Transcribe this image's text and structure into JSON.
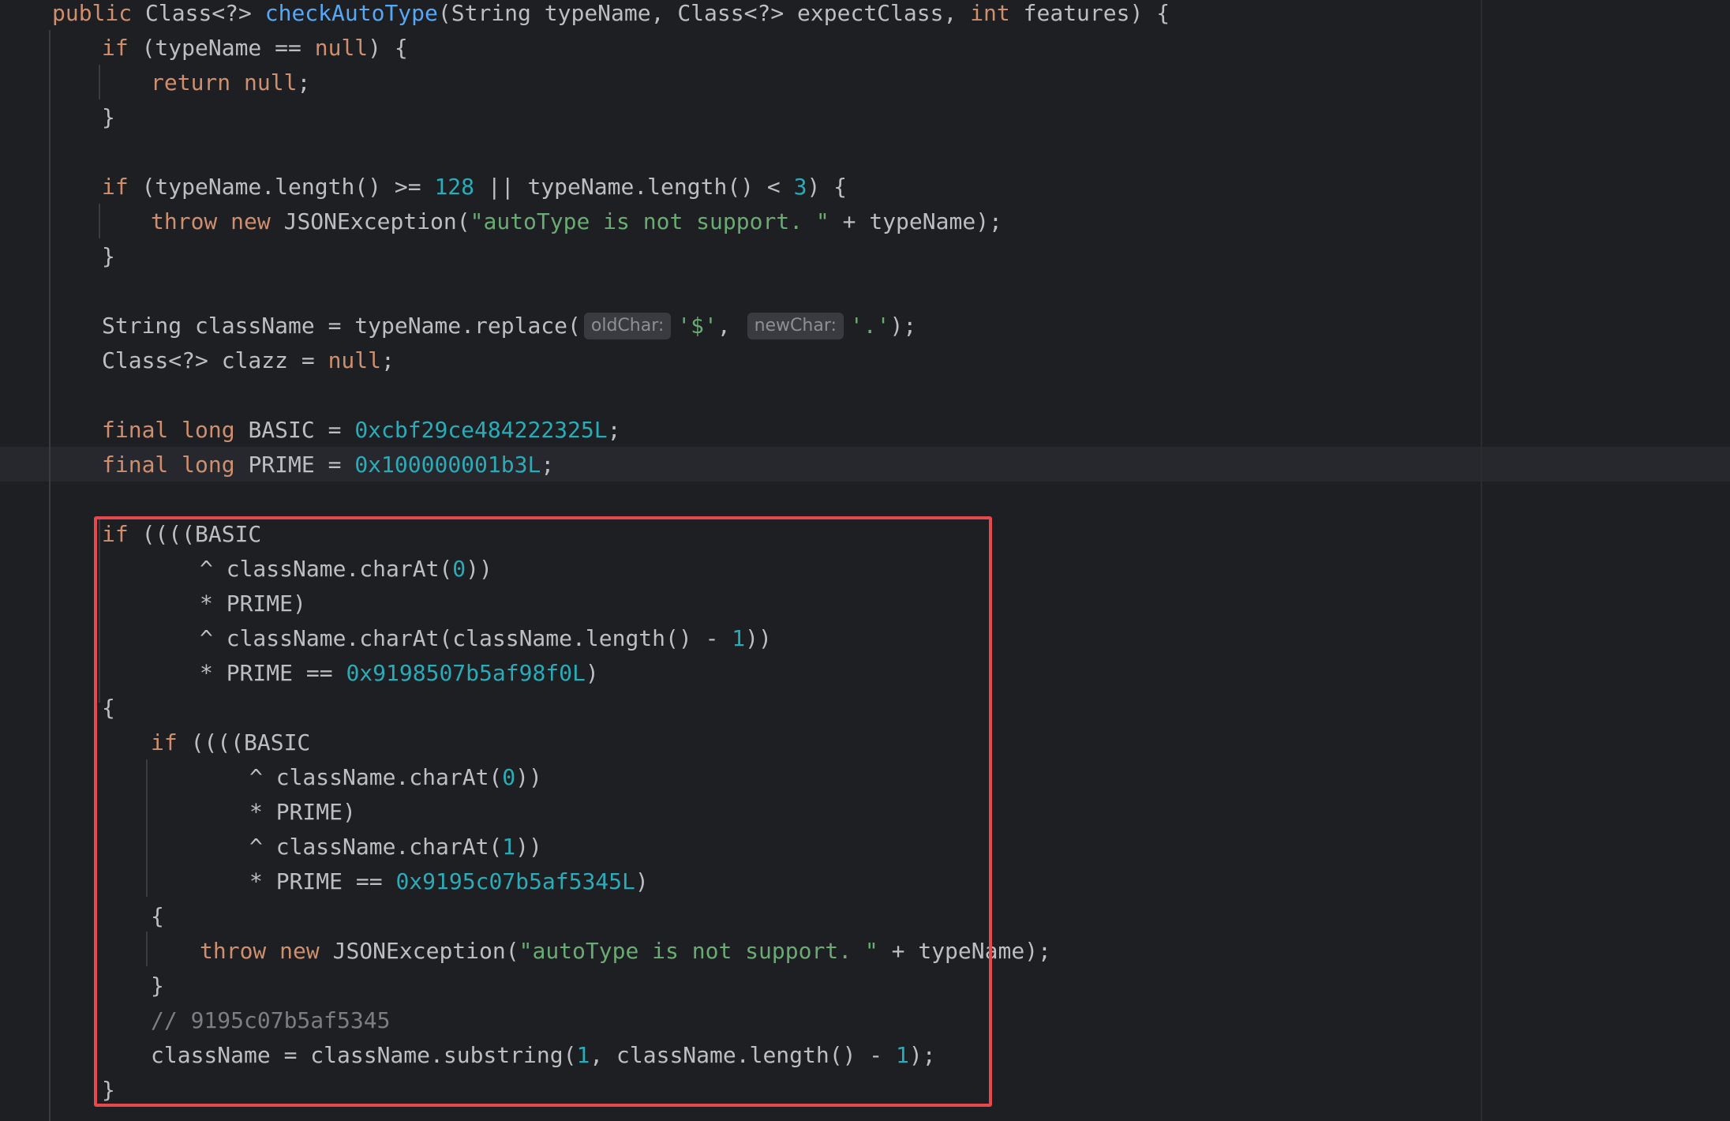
{
  "colors": {
    "background": "#1e1f22",
    "keyword": "#cf8e6d",
    "function_name": "#56a8f5",
    "number": "#2aacb8",
    "string": "#6aab73",
    "comment": "#7a7e85",
    "text": "#bcbec4",
    "highlight_border": "#e5484d"
  },
  "code": {
    "line1": {
      "t1": "public",
      "t2": " Class<?> ",
      "t3": "checkAutoType",
      "t4": "(String typeName, Class<?> expectClass, ",
      "t5": "int",
      "t6": " features) {"
    },
    "line2": {
      "t1": "if",
      "t2": " (typeName == ",
      "t3": "null",
      "t4": ") {"
    },
    "line3": {
      "t1": "return",
      "t2": " ",
      "t3": "null",
      "t4": ";"
    },
    "line4": {
      "t1": "}"
    },
    "line6": {
      "t1": "if",
      "t2": " (typeName.length() >= ",
      "t3": "128",
      "t4": " || typeName.length() < ",
      "t5": "3",
      "t6": ") {"
    },
    "line7": {
      "t1": "throw",
      "t2": " ",
      "t3": "new",
      "t4": " JSONException(",
      "t5": "\"autoType is not support. \"",
      "t6": " + typeName);"
    },
    "line8": {
      "t1": "}"
    },
    "line10": {
      "t1": "String className = typeName.replace(",
      "hint1": "oldChar:",
      "t2": "'$'",
      "t3": ", ",
      "hint2": "newChar:",
      "t4": "'.'",
      "t5": ");"
    },
    "line11": {
      "t1": "Class<?> clazz = ",
      "t2": "null",
      "t3": ";"
    },
    "line13": {
      "t1": "final",
      "t2": " ",
      "t3": "long",
      "t4": " BASIC = ",
      "t5": "0xcbf29ce484222325L",
      "t6": ";"
    },
    "line14": {
      "t1": "final",
      "t2": " ",
      "t3": "long",
      "t4": " PRIME = ",
      "t5": "0x100000001b3L",
      "t6": ";"
    },
    "line16": {
      "t1": "if",
      "t2": " ((((BASIC"
    },
    "line17": {
      "t1": "^ className.charAt(",
      "t2": "0",
      "t3": "))"
    },
    "line18": {
      "t1": "* PRIME)"
    },
    "line19": {
      "t1": "^ className.charAt(className.length() - ",
      "t2": "1",
      "t3": "))"
    },
    "line20": {
      "t1": "* PRIME == ",
      "t2": "0x9198507b5af98f0L",
      "t3": ")"
    },
    "line21": {
      "t1": "{"
    },
    "line22": {
      "t1": "if",
      "t2": " ((((BASIC"
    },
    "line23": {
      "t1": "^ className.charAt(",
      "t2": "0",
      "t3": "))"
    },
    "line24": {
      "t1": "* PRIME)"
    },
    "line25": {
      "t1": "^ className.charAt(",
      "t2": "1",
      "t3": "))"
    },
    "line26": {
      "t1": "* PRIME == ",
      "t2": "0x9195c07b5af5345L",
      "t3": ")"
    },
    "line27": {
      "t1": "{"
    },
    "line28": {
      "t1": "throw",
      "t2": " ",
      "t3": "new",
      "t4": " JSONException(",
      "t5": "\"autoType is not support. \"",
      "t6": " + typeName);"
    },
    "line29": {
      "t1": "}"
    },
    "line30": {
      "t1": "// 9195c07b5af5345"
    },
    "line31": {
      "t1": "className = className.substring(",
      "t2": "1",
      "t3": ", className.length() - ",
      "t4": "1",
      "t5": ");"
    },
    "line32": {
      "t1": "}"
    }
  }
}
